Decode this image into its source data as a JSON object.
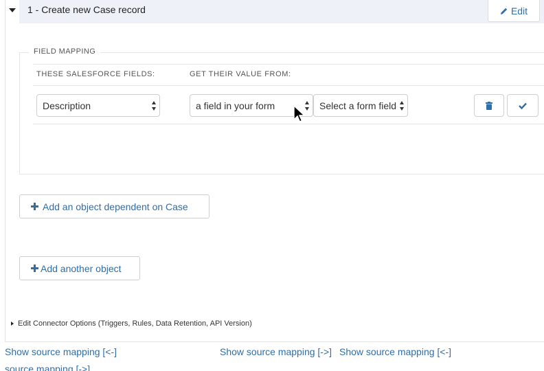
{
  "header": {
    "title": "1 - Create new Case record",
    "edit_label": "Edit"
  },
  "field_mapping": {
    "legend": "FIELD MAPPING",
    "col_salesforce": "THESE SALESFORCE FIELDS:",
    "col_value": "GET THEIR VALUE FROM:",
    "row": {
      "salesforce_field": "Description",
      "value_source": "a field in your form",
      "form_field": "Select a form field"
    }
  },
  "buttons": {
    "add_dependent": "Add an object dependent on Case",
    "add_another": "Add another object"
  },
  "connector_options": "Edit Connector Options (Triggers, Rules, Data Retention, API Version)",
  "links": {
    "show_source_left_1": "Show source mapping [<-]",
    "show_source_right": "Show source mapping [->]",
    "show_source_left_2": "Show source mapping [<-]",
    "source_mapping_partial": "source mapping [->]"
  },
  "colors": {
    "accent": "#2e6ea9",
    "header_bg": "#eef2f8"
  },
  "icons": {
    "collapse": "caret-down-icon",
    "edit": "pencil-icon",
    "delete": "trash-icon",
    "confirm": "check-icon",
    "add": "plus-icon",
    "expand": "caret-right-icon"
  }
}
